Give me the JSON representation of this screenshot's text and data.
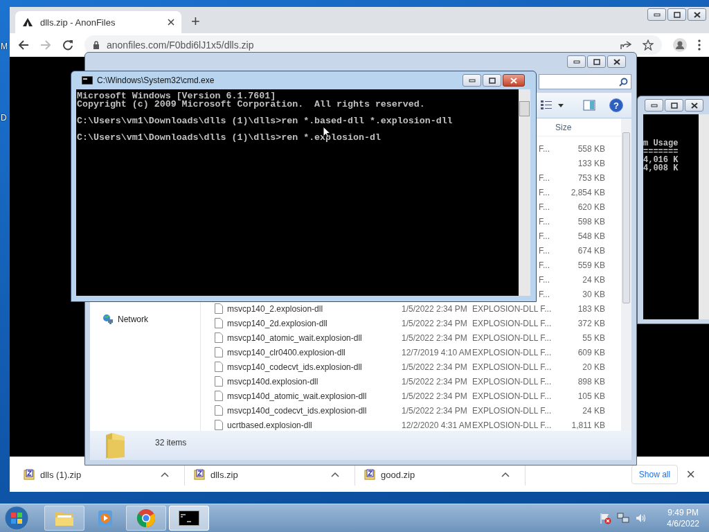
{
  "desktop": {
    "icon_labels": [
      "M",
      "D"
    ]
  },
  "browser": {
    "tab_title": "dlls.zip - AnonFiles",
    "new_tab": "+",
    "address": "anonfiles.com/F0bdi6lJ1x5/dlls.zip",
    "downloads": [
      {
        "name": "dlls (1).zip"
      },
      {
        "name": "dlls.zip"
      },
      {
        "name": "good.zip"
      }
    ],
    "show_all": "Show all",
    "close": "×"
  },
  "explorer": {
    "help": "?",
    "columns": [
      "Size"
    ],
    "nav_items": [
      "Network"
    ],
    "rows": [
      {
        "type": "F...",
        "size": "558 KB"
      },
      {
        "size": "133 KB"
      },
      {
        "type": "F...",
        "size": "753 KB"
      },
      {
        "type": "F...",
        "size": "2,854 KB"
      },
      {
        "type": "F...",
        "size": "620 KB"
      },
      {
        "type": "F...",
        "size": "598 KB"
      },
      {
        "type": "F...",
        "size": "548 KB"
      },
      {
        "type": "F...",
        "size": "674 KB"
      },
      {
        "type": "F...",
        "size": "559 KB"
      },
      {
        "type": "F...",
        "size": "24 KB"
      },
      {
        "type": "F...",
        "size": "30 KB"
      },
      {
        "name": "msvcp140_2.explosion-dll",
        "date": "1/5/2022 2:34 PM",
        "type": "EXPLOSION-DLL F...",
        "size": "183 KB"
      },
      {
        "name": "msvcp140_2d.explosion-dll",
        "date": "1/5/2022 2:34 PM",
        "type": "EXPLOSION-DLL F...",
        "size": "372 KB"
      },
      {
        "name": "msvcp140_atomic_wait.explosion-dll",
        "date": "1/5/2022 2:34 PM",
        "type": "EXPLOSION-DLL F...",
        "size": "55 KB"
      },
      {
        "name": "msvcp140_clr0400.explosion-dll",
        "date": "12/7/2019 4:10 AM",
        "type": "EXPLOSION-DLL F...",
        "size": "609 KB"
      },
      {
        "name": "msvcp140_codecvt_ids.explosion-dll",
        "date": "1/5/2022 2:34 PM",
        "type": "EXPLOSION-DLL F...",
        "size": "20 KB"
      },
      {
        "name": "msvcp140d.explosion-dll",
        "date": "1/5/2022 2:34 PM",
        "type": "EXPLOSION-DLL F...",
        "size": "898 KB"
      },
      {
        "name": "msvcp140d_atomic_wait.explosion-dll",
        "date": "1/5/2022 2:34 PM",
        "type": "EXPLOSION-DLL F...",
        "size": "105 KB"
      },
      {
        "name": "msvcp140d_codecvt_ids.explosion-dll",
        "date": "1/5/2022 2:34 PM",
        "type": "EXPLOSION-DLL F...",
        "size": "24 KB"
      },
      {
        "name": "ucrtbased.explosion-dll",
        "date": "12/2/2020 4:31 AM",
        "type": "EXPLOSION-DLL F...",
        "size": "1,811 KB"
      }
    ],
    "status": "32 items"
  },
  "console_back": {
    "lines": [
      "m Usage",
      "=======",
      "4,016 K",
      "4,008 K"
    ]
  },
  "console": {
    "title": "C:\\Windows\\System32\\cmd.exe",
    "blocks": [
      [
        "Microsoft Windows [Version 6.1.7601]",
        "Copyright (c) 2009 Microsoft Corporation.  All rights reserved."
      ],
      [
        "C:\\Users\\vm1\\Downloads\\dlls (1)\\dlls>ren *.based-dll *.explosion-dll"
      ],
      [
        "C:\\Users\\vm1\\Downloads\\dlls (1)\\dlls>ren *.explosion-dl"
      ]
    ]
  },
  "taskbar": {
    "apps": [
      {
        "kind": "explorer",
        "selected": false
      },
      {
        "kind": "media",
        "selected": false
      },
      {
        "kind": "chrome",
        "selected": false
      },
      {
        "kind": "console",
        "selected": true
      }
    ],
    "clock": {
      "time": "9:49 PM",
      "date": "4/6/2022"
    }
  }
}
